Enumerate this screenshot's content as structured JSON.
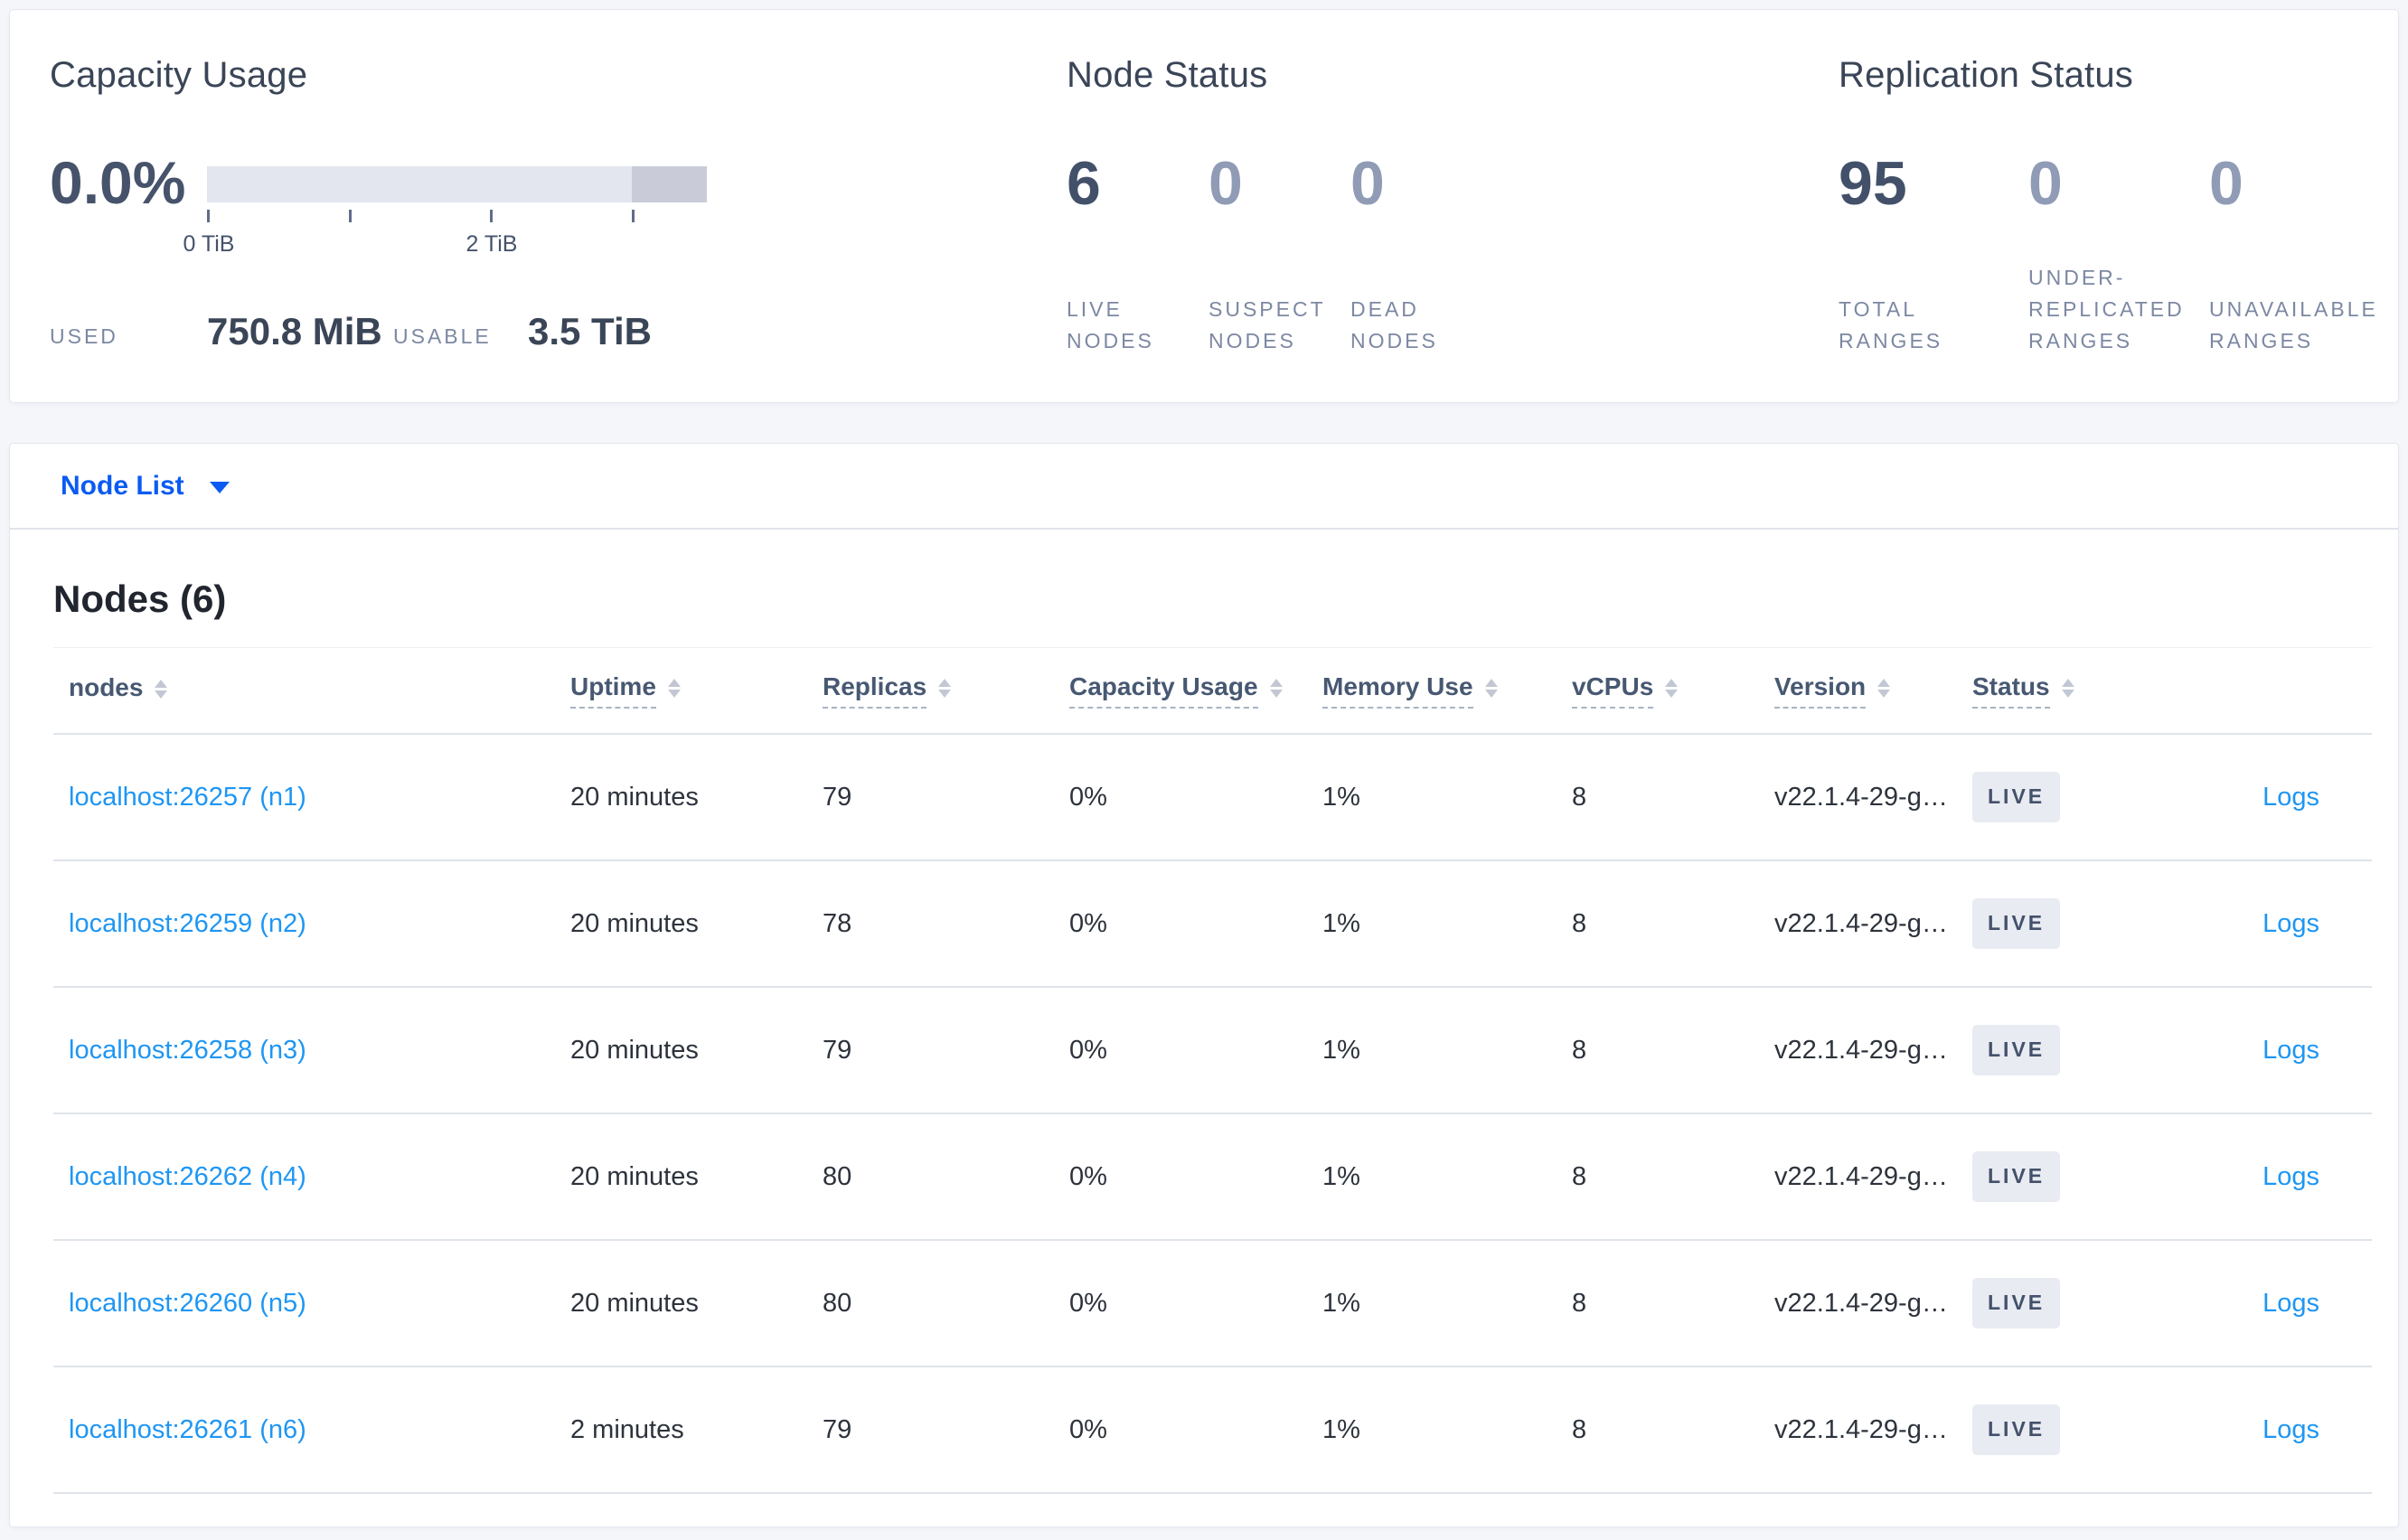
{
  "colors": {
    "page_background": "#f4f6fa",
    "accent_blue": "#0b5bf3",
    "link_blue": "#1e96f3",
    "dark_stat": "#42506a",
    "muted_stat": "#909bb5",
    "bar_track": "#e4e6ef",
    "bar_tail": "#c9ccd8",
    "live_badge_bg": "#e8ebf1"
  },
  "summary": {
    "capacity": {
      "title": "Capacity Usage",
      "percent": "0.0%",
      "axis_ticks": [
        "0 TiB",
        "",
        "2 TiB",
        ""
      ],
      "used_label": "USED",
      "used_value": "750.8 MiB",
      "usable_label": "USABLE",
      "usable_value": "3.5 TiB"
    },
    "node_status": {
      "title": "Node Status",
      "stats": [
        {
          "value": "6",
          "label": "LIVE NODES"
        },
        {
          "value": "0",
          "label": "SUSPECT NODES"
        },
        {
          "value": "0",
          "label": "DEAD NODES"
        }
      ]
    },
    "replication_status": {
      "title": "Replication Status",
      "stats": [
        {
          "value": "95",
          "label": "TOTAL RANGES"
        },
        {
          "value": "0",
          "label": "UNDER-REPLICATED RANGES"
        },
        {
          "value": "0",
          "label": "UNAVAILABLE RANGES"
        }
      ]
    }
  },
  "node_list": {
    "dropdown_label": "Node List",
    "section_title": "Nodes (6)",
    "columns": [
      "nodes",
      "Uptime",
      "Replicas",
      "Capacity Usage",
      "Memory Use",
      "vCPUs",
      "Version",
      "Status"
    ],
    "rows": [
      {
        "node": "localhost:26257 (n1)",
        "uptime": "20 minutes",
        "replicas": "79",
        "capacity": "0%",
        "memory": "1%",
        "vcpus": "8",
        "version": "v22.1.4-29-g…",
        "status": "LIVE",
        "logs": "Logs"
      },
      {
        "node": "localhost:26259 (n2)",
        "uptime": "20 minutes",
        "replicas": "78",
        "capacity": "0%",
        "memory": "1%",
        "vcpus": "8",
        "version": "v22.1.4-29-g…",
        "status": "LIVE",
        "logs": "Logs"
      },
      {
        "node": "localhost:26258 (n3)",
        "uptime": "20 minutes",
        "replicas": "79",
        "capacity": "0%",
        "memory": "1%",
        "vcpus": "8",
        "version": "v22.1.4-29-g…",
        "status": "LIVE",
        "logs": "Logs"
      },
      {
        "node": "localhost:26262 (n4)",
        "uptime": "20 minutes",
        "replicas": "80",
        "capacity": "0%",
        "memory": "1%",
        "vcpus": "8",
        "version": "v22.1.4-29-g…",
        "status": "LIVE",
        "logs": "Logs"
      },
      {
        "node": "localhost:26260 (n5)",
        "uptime": "20 minutes",
        "replicas": "80",
        "capacity": "0%",
        "memory": "1%",
        "vcpus": "8",
        "version": "v22.1.4-29-g…",
        "status": "LIVE",
        "logs": "Logs"
      },
      {
        "node": "localhost:26261 (n6)",
        "uptime": "2 minutes",
        "replicas": "79",
        "capacity": "0%",
        "memory": "1%",
        "vcpus": "8",
        "version": "v22.1.4-29-g…",
        "status": "LIVE",
        "logs": "Logs"
      }
    ]
  }
}
